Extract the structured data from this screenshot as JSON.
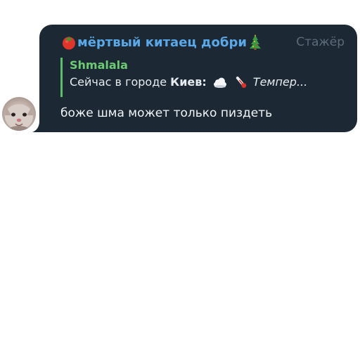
{
  "message": {
    "sender_name": "мёртвый китаец добри",
    "sender_prefix_icon": "tomato-emoji",
    "sender_suffix_icon": "christmas-tree-emoji",
    "role_badge": "Стажёр",
    "reply": {
      "author": "Shmalala",
      "text_prefix": "Сейчас в городе",
      "city": "Киев:",
      "weather_icon": "cloud-emoji",
      "temp_icon": "thermometer-emoji",
      "text_suffix": "Темпер..."
    },
    "text": "боже шма может только пиздеть"
  },
  "colors": {
    "bubble_bg": "#1c2834",
    "sender": "#5aa8e8",
    "reply_accent": "#5cbf6a",
    "role": "#5d6b79"
  }
}
